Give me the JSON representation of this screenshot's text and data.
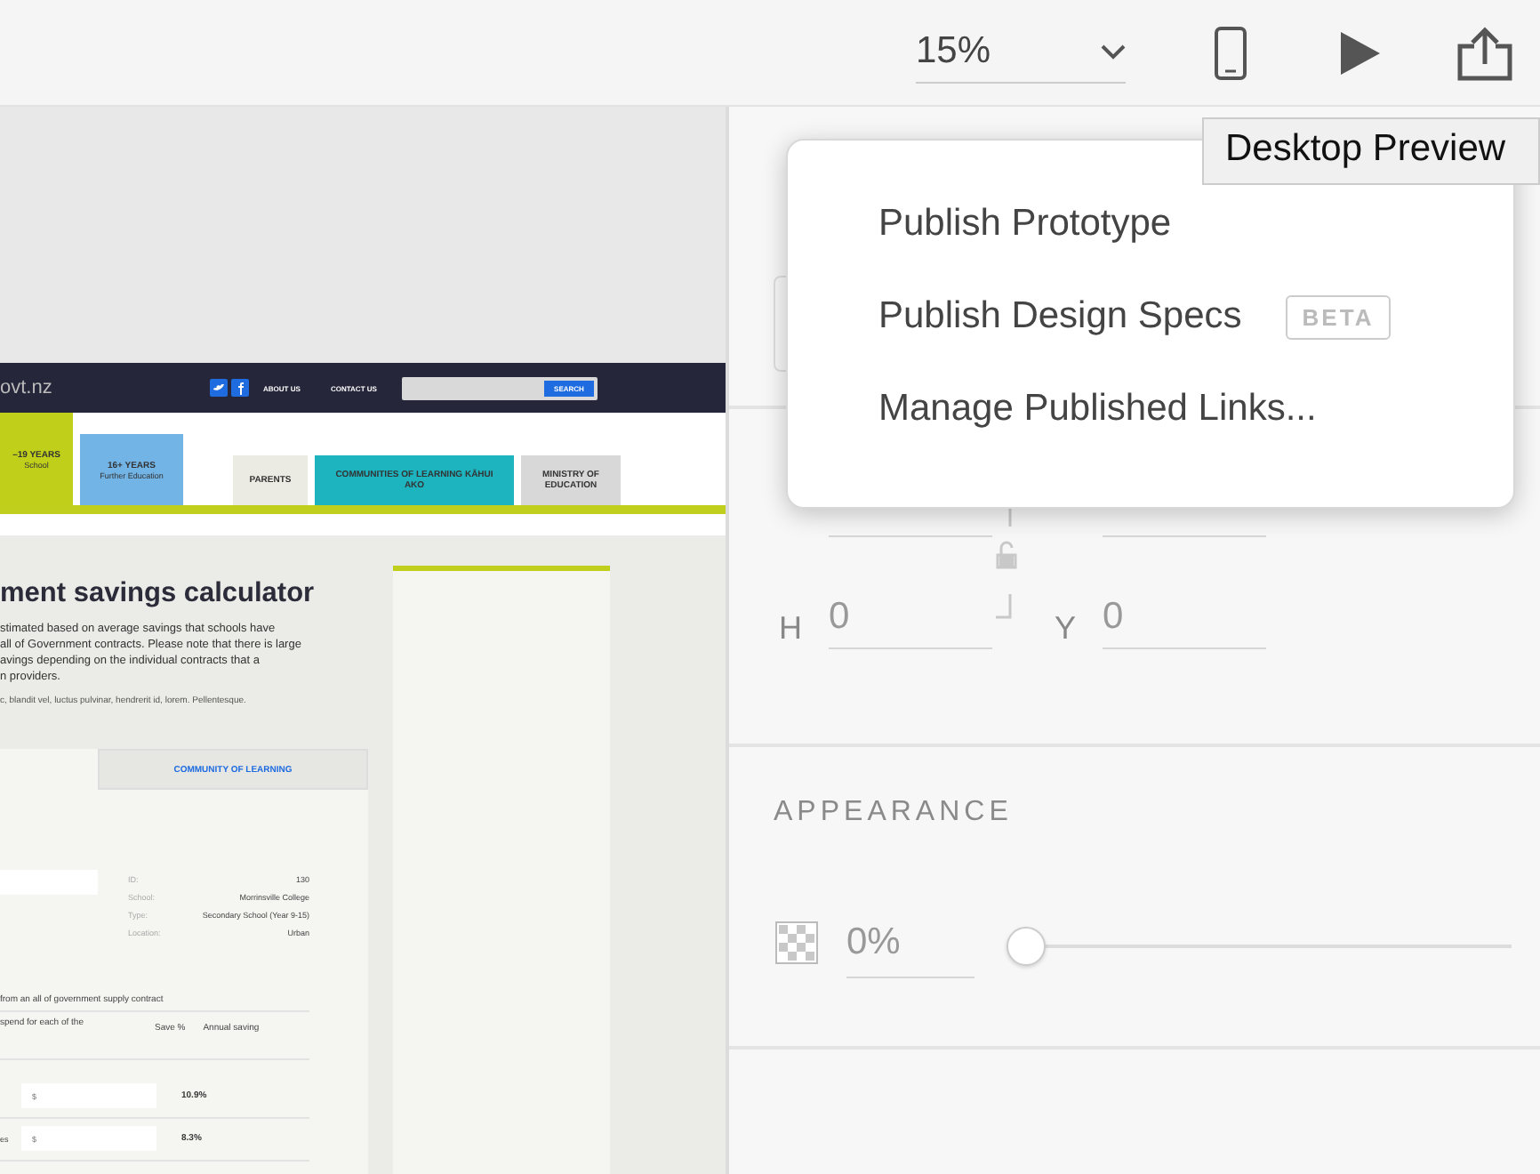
{
  "toolbar": {
    "zoom": "15%",
    "preview_tooltip": "Desktop Preview"
  },
  "publish_menu": {
    "items": [
      {
        "label": "Publish Prototype"
      },
      {
        "label": "Publish Design Specs",
        "badge": "BETA"
      },
      {
        "label": "Manage Published Links..."
      }
    ]
  },
  "properties": {
    "height_label": "H",
    "height_value": "0",
    "y_label": "Y",
    "y_value": "0",
    "appearance": {
      "title": "APPEARANCE",
      "opacity": "0%",
      "level": 0
    }
  },
  "artboard": {
    "site_name": "ovt.nz",
    "header_links": [
      "ABOUT US",
      "CONTACT US"
    ],
    "search_button": "SEARCH",
    "nav_tiles": [
      {
        "title": "–19 YEARS",
        "subtitle": "School",
        "color": "#bfcf1a"
      },
      {
        "title": "16+ YEARS",
        "subtitle": "Further Education",
        "color": "#72b4e6"
      },
      {
        "title": "PARENTS",
        "color": "#ecebe3"
      },
      {
        "title": "COMMUNITIES OF LEARNING KĀHUI AKO",
        "color": "#1db3bf"
      },
      {
        "title": "MINISTRY OF EDUCATION",
        "color": "#d8d8d8"
      }
    ],
    "heading": "ment savings calculator",
    "intro_lines": [
      "stimated based on average savings that schools have",
      "all of Government contracts. Please note that there is large",
      "avings depending on the individual contracts that a",
      "n providers."
    ],
    "lorem": "c, blandit vel, luctus pulvinar, hendrerit id, lorem. Pellentesque.",
    "tab": "COMMUNITY OF LEARNING",
    "details": [
      {
        "label": "ID:",
        "value": "130"
      },
      {
        "label": "School:",
        "value": "Morrinsville College"
      },
      {
        "label": "Type:",
        "value": "Secondary School (Year 9-15)"
      },
      {
        "label": "Location:",
        "value": "Urban"
      }
    ],
    "contract_note": "from an all of government supply contract",
    "spend_label": "spend for each of the",
    "columns": [
      "Save %",
      "Annual saving"
    ],
    "rows": [
      {
        "placeholder": "$",
        "save": "10.9%"
      },
      {
        "label": "es",
        "placeholder": "$",
        "save": "8.3%"
      }
    ]
  }
}
